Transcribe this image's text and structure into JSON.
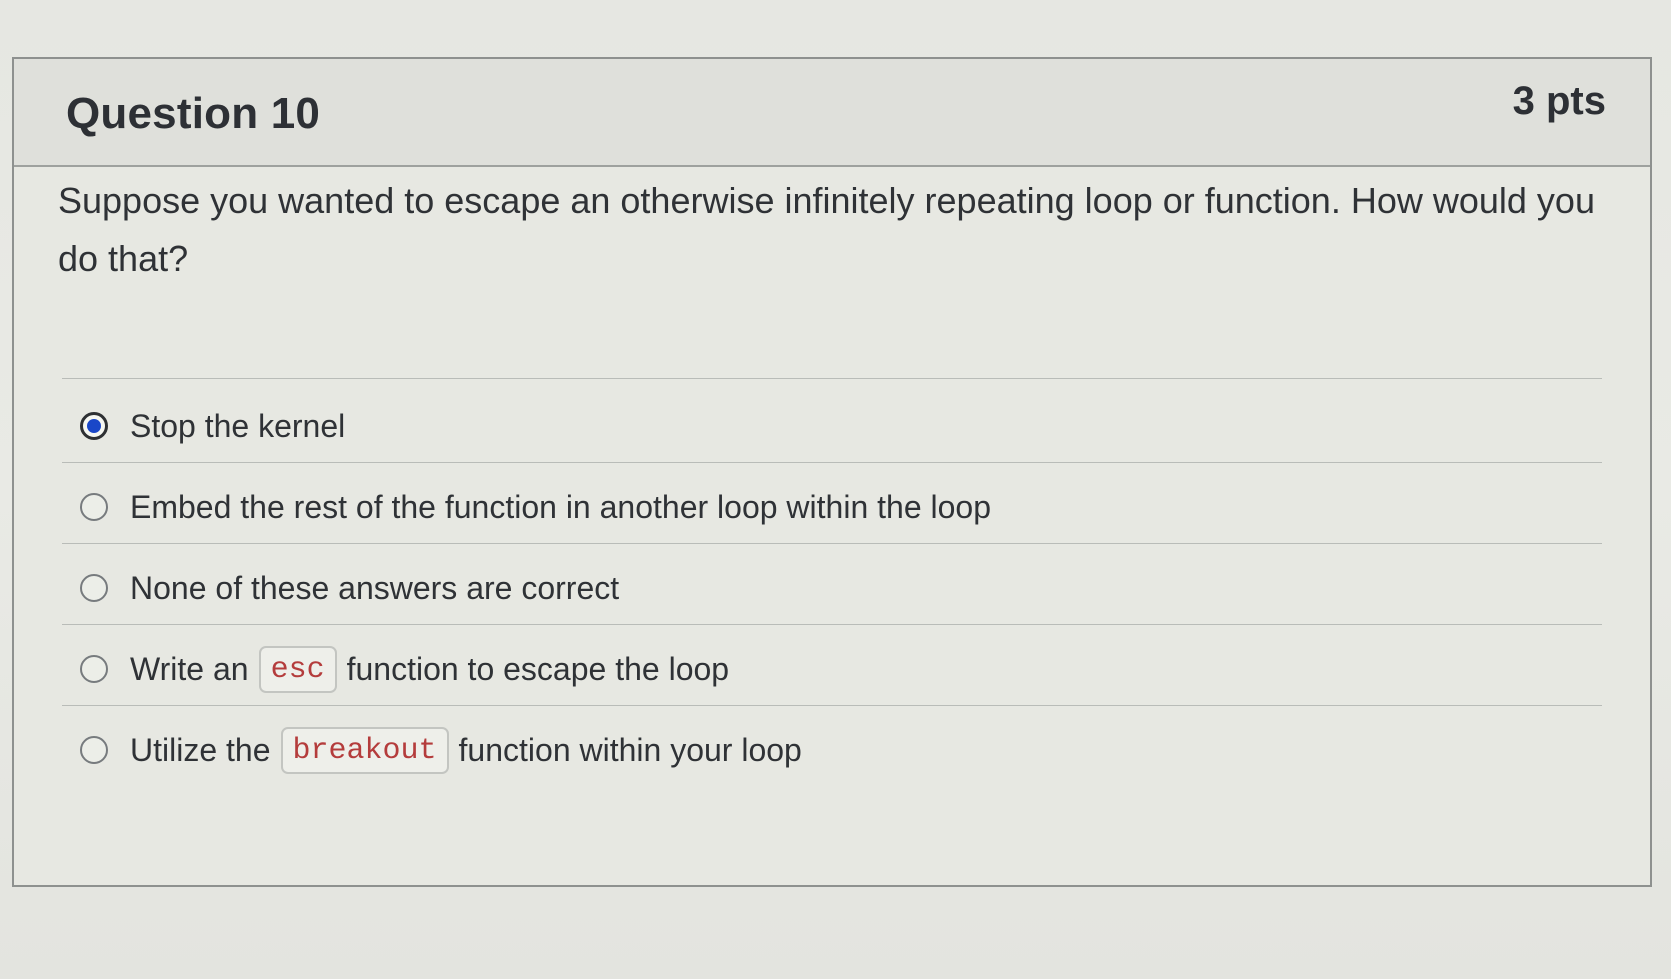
{
  "question": {
    "title": "Question 10",
    "points": "3 pts",
    "text": "Suppose you wanted to escape an otherwise infinitely repeating loop or function. How would you do that?"
  },
  "answers": [
    {
      "label": "Stop the kernel",
      "selected": true
    },
    {
      "label": "Embed the rest of the function in another loop within the loop",
      "selected": false
    },
    {
      "label": "None of these answers are correct",
      "selected": false
    },
    {
      "before": "Write an",
      "code": "esc",
      "after": "function to escape the loop",
      "selected": false
    },
    {
      "before": "Utilize the",
      "code": "breakout",
      "after": "function within your loop",
      "selected": false
    }
  ],
  "colors": {
    "radio_selected": "#1a47c8",
    "code_text": "#b43c3c"
  }
}
